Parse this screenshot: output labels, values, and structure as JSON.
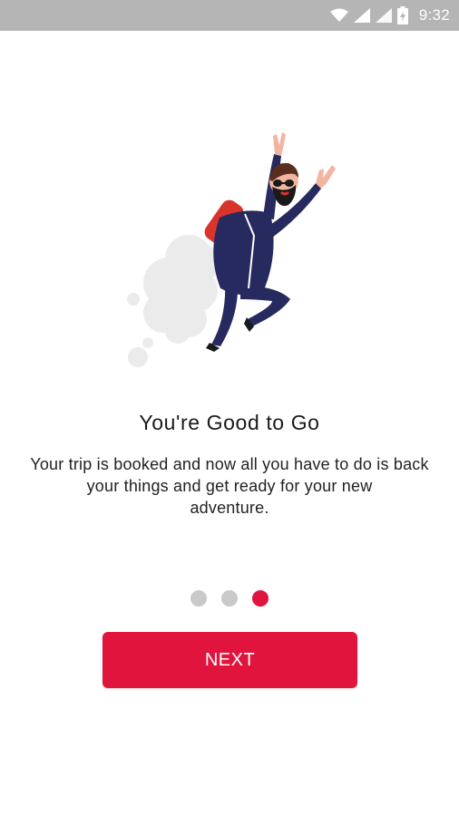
{
  "status_bar": {
    "time": "9:32",
    "icons": [
      "wifi-icon",
      "signal-icon",
      "signal-icon",
      "battery-icon"
    ]
  },
  "onboarding": {
    "title": "You're Good to Go",
    "subtitle": "Your trip is booked and now all you have to do is back your things and get ready for your new\nadventure.",
    "pager": {
      "total": 3,
      "active": 3
    },
    "next_label": "NEXT"
  },
  "colors": {
    "accent": "#e0143c",
    "dot_inactive": "#c9c9c9",
    "status_bar": "#b5b5b5",
    "suit": "#262a5e"
  }
}
